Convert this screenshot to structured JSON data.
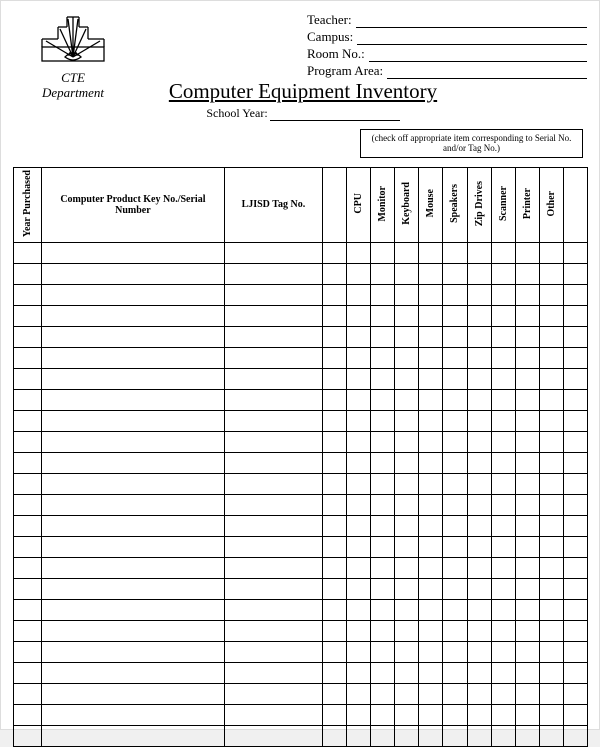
{
  "header": {
    "dept_line1": "CTE",
    "dept_line2": "Department",
    "fields": {
      "teacher": "Teacher:",
      "campus": "Campus:",
      "room": "Room No.:",
      "program": "Program Area:"
    }
  },
  "title": "Computer Equipment Inventory",
  "school_year_label": "School Year:",
  "note": "(check off appropriate item corresponding to Serial No. and/or Tag No.)",
  "columns": {
    "year": "Year Purchased",
    "serial": "Computer Product Key No./Serial Number",
    "tag": "LJISD Tag No.",
    "items": [
      "CPU",
      "Monitor",
      "Keyboard",
      "Mouse",
      "Speakers",
      "Zip Drives",
      "Scanner",
      "Printer",
      "Other"
    ]
  },
  "row_count": 24
}
